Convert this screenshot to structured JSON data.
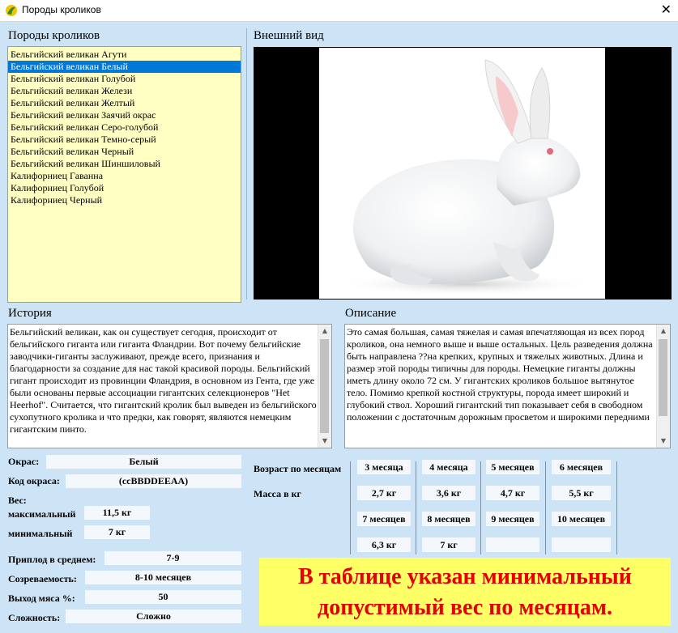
{
  "window": {
    "title": "Породы кроликов",
    "close_glyph": "✕",
    "icon": "app-logo-icon"
  },
  "left_panel": {
    "title": "Породы кроликов",
    "items": [
      "Бельгийский великан Агути",
      "Бельгийский великан Белый",
      "Бельгийский великан Голубой",
      "Бельгийский великан Желези",
      "Бельгийский великан Желтый",
      "Бельгийский великан Заячий окрас",
      "Бельгийский великан Серо-голубой",
      "Бельгийский великан Темно-серый",
      "Бельгийский великан Черный",
      "Бельгийский великан Шиншиловый",
      "Калифорниец Гаванна",
      "Калифорниец Голубой",
      "Калифорниец Черный"
    ],
    "selected_index": 1
  },
  "appearance": {
    "title": "Внешний вид"
  },
  "history": {
    "title": "История",
    "text": "Бельгийский великан, как он существует сегодня, происходит от бельгийского гиганта или гиганта Фландрии. Вот почему бельгийские заводчики-гиганты заслуживают, прежде всего, признания и благодарности за создание для нас такой красивой породы. Бельгийский гигант происходит из провинции Фландрия, в основном из Гента, где уже были основаны первые ассоциации гигантских селекционеров \"Het Heerhof\". Считается, что гигантский кролик был выведен из бельгийского сухопутного кролика и что предки, как говорят, являются немецким гигантским пинто."
  },
  "description": {
    "title": "Описание",
    "text": "Это самая большая, самая тяжелая и самая впечатляющая из всех пород кроликов, она немного выше и выше остальных. Цель разведения должна быть направлена ??на крепких, крупных и тяжелых животных. Длина и размер этой породы типичны для породы. Немецкие гиганты должны иметь длину около 72 см. У гигантских кроликов большое вытянутое тело. Помимо крепкой костной структуры, порода имеет широкий и глубокий ствол. Хороший гигантский тип показывает себя в свободном положении с достаточным дорожным просветом и широкими передними"
  },
  "specs": {
    "color_label": "Окрас:",
    "color_value": "Белый",
    "code_label": "Код окраса:",
    "code_value": "(ccBBDDEEAA)",
    "weight_label": "Вес:",
    "max_label": "максимальный",
    "max_value": "11,5 кг",
    "min_label": "минимальный",
    "min_value": "7 кг",
    "litter_label": "Приплод в среднем:",
    "litter_value": "7-9",
    "maturity_label": "Созреваемость:",
    "maturity_value": "8-10 месяцев",
    "meat_label": "Выход мяса %:",
    "meat_value": "50",
    "difficulty_label": "Сложность:",
    "difficulty_value": "Сложно"
  },
  "age_table": {
    "age_label": "Возраст по месяцам",
    "mass_label": "Масса в кг",
    "row1": [
      {
        "age": "3 месяца",
        "mass": "2,7 кг"
      },
      {
        "age": "4 месяца",
        "mass": "3,6 кг"
      },
      {
        "age": "5 месяцев",
        "mass": "4,7 кг"
      },
      {
        "age": "6 месяцев",
        "mass": "5,5 кг"
      }
    ],
    "row2": [
      {
        "age": "7 месяцев",
        "mass": "6,3 кг"
      },
      {
        "age": "8 месяцев",
        "mass": "7 кг"
      },
      {
        "age": "9 месяцев",
        "mass": ""
      },
      {
        "age": "10 месяцев",
        "mass": ""
      }
    ]
  },
  "banner": {
    "line1": "В таблице указан минимальный",
    "line2": "допустимый вес по месяцам."
  },
  "colors": {
    "selection": "#0078d7",
    "list_bg": "#ffffc4",
    "window_bg": "#cde3f6",
    "banner_bg": "#ffff66",
    "banner_text": "#e40000"
  }
}
